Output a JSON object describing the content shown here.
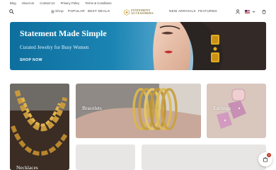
{
  "topbar": {
    "links": [
      "Blog",
      "About Us",
      "Contact Us",
      "Privacy Policy",
      "Terms & Conditions"
    ]
  },
  "header": {
    "shop_label": "Shop",
    "nav_left": [
      "POPULAR",
      "BEST DEALS"
    ],
    "nav_right": [
      "NEW ARRIVALS",
      "FEATURED"
    ],
    "logo_line1": "STATEMENT",
    "logo_line2": "ACCESSORIES",
    "icons": [
      "search-icon",
      "menu-icon",
      "user-icon",
      "flag-icon",
      "chevron-down-icon",
      "cart-icon"
    ]
  },
  "hero": {
    "title": "Statement Made Simple",
    "subtitle": "Curated Jewelry for Busy Women",
    "cta": "SHOP NOW"
  },
  "categories": [
    {
      "label": "Necklaces"
    },
    {
      "label": "Bracelets"
    },
    {
      "label": "Earrings"
    },
    {
      "label": ""
    },
    {
      "label": ""
    }
  ],
  "chat": {
    "badge": "1",
    "icon": "chat-icon"
  },
  "colors": {
    "hero_blue": "#1b84b3",
    "gold": "#c9a646",
    "badge_red": "#c0392b"
  }
}
